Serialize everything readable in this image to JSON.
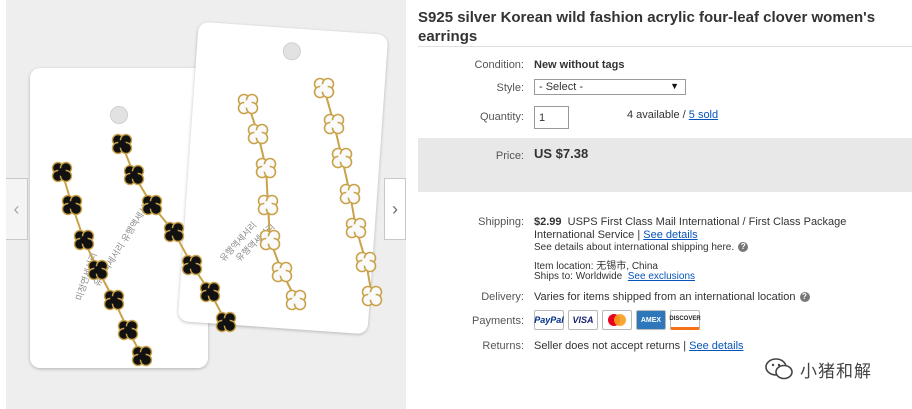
{
  "gallery": {
    "prev_label": "‹",
    "next_label": "›",
    "card_print_lines": [
      "미정연세서리",
      "유행액세서리 유행액세서리",
      "유행액세서리",
      "유행액세서리"
    ]
  },
  "listing": {
    "title": "S925 silver Korean wild fashion acrylic four-leaf clover women's earrings",
    "condition": {
      "label": "Condition:",
      "value": "New without tags"
    },
    "style": {
      "label": "Style:",
      "selected": "- Select -"
    },
    "quantity": {
      "label": "Quantity:",
      "value": "1",
      "available": "4 available / ",
      "sold": "5 sold"
    },
    "price": {
      "label": "Price:",
      "value": "US $7.38"
    },
    "shipping": {
      "label": "Shipping:",
      "cost": "$2.99",
      "service": "USPS First Class Mail International / First Class Package International Service | ",
      "details_link": "See details",
      "intl_note": "See details about international shipping here.",
      "item_location_label": "Item location:",
      "item_location": "无锡市, China",
      "ships_to_label": "Ships to:",
      "ships_to": "Worldwide",
      "exclusions_link": "See exclusions"
    },
    "delivery": {
      "label": "Delivery:",
      "value": "Varies for items shipped from an international location"
    },
    "payments": {
      "label": "Payments:",
      "methods": [
        "PayPal",
        "VISA",
        "",
        "AMEX",
        "DISCOVER"
      ]
    },
    "returns": {
      "label": "Returns:",
      "value": "Seller does not accept returns | ",
      "details_link": "See details"
    }
  },
  "watermark": {
    "text": "小猪和解"
  },
  "colors": {
    "link": "#0654ba",
    "price_box": "#e8e8e8",
    "gold": "#c9a24a",
    "enamel_black": "#111111"
  }
}
